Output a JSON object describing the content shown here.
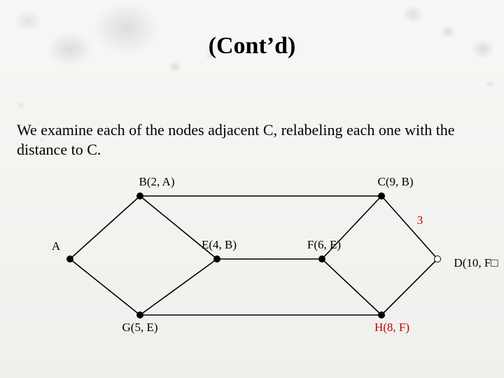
{
  "title": "(Cont’d)",
  "body_text": "We examine each of the nodes adjacent C, relabeling each one with the distance  to C.",
  "graph": {
    "edge_weight_CD": "3",
    "nodes": {
      "A": {
        "label": "A"
      },
      "B": {
        "label": "B(2, A)"
      },
      "C": {
        "label": "C(9, B)"
      },
      "D": {
        "label": "D(10, F□"
      },
      "E": {
        "label": "E(4, B)"
      },
      "F": {
        "label": "F(6, E)"
      },
      "G": {
        "label": "G(5, E)"
      },
      "H": {
        "label": "H(8, F)"
      }
    }
  }
}
